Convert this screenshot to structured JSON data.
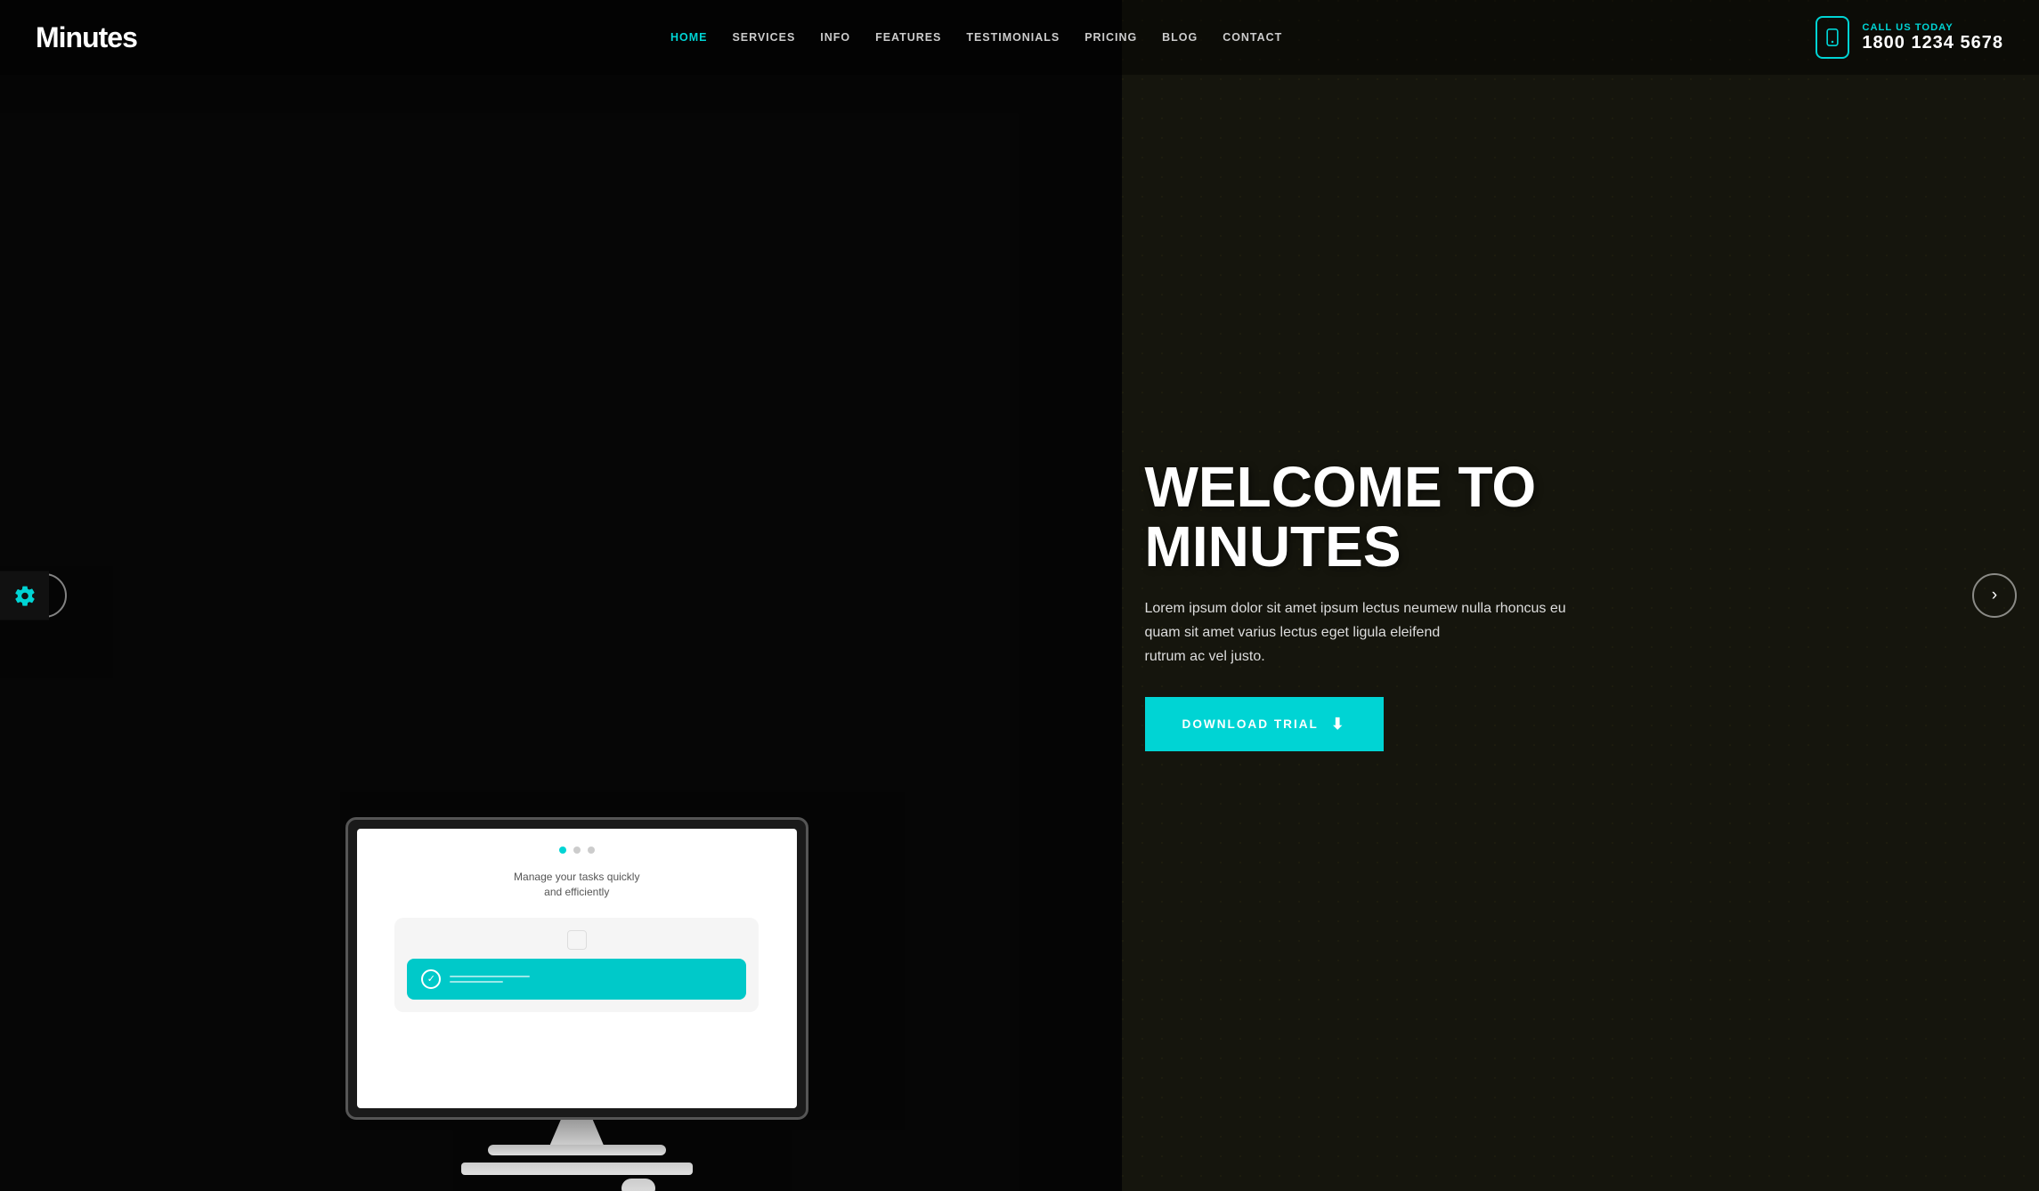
{
  "brand": {
    "logo": "Minutes"
  },
  "nav": {
    "items": [
      {
        "label": "HOME",
        "active": true
      },
      {
        "label": "SERVICES",
        "active": false
      },
      {
        "label": "INFO",
        "active": false
      },
      {
        "label": "FEATURES",
        "active": false
      },
      {
        "label": "TESTIMONIALS",
        "active": false
      },
      {
        "label": "PRICING",
        "active": false
      },
      {
        "label": "BLOG",
        "active": false
      },
      {
        "label": "CONTACT",
        "active": false
      }
    ]
  },
  "header": {
    "call_label": "CALL US TODAY",
    "phone": "1800 1234 5678"
  },
  "hero": {
    "title_line1": "WELCOME TO",
    "title_line2": "MINUTES",
    "description": "Lorem ipsum dolor sit amet ipsum lectus neumew nulla rhoncus eu quam sit amet varius lectus eget ligula eleifend\nrutrum ac vel justo.",
    "cta_label": "DOWNLOAD TRIAL",
    "screen_title": "Manage your tasks quickly\nand efficiently",
    "dots": [
      "active",
      "inactive",
      "inactive"
    ],
    "prev_label": "‹",
    "next_label": "›"
  }
}
